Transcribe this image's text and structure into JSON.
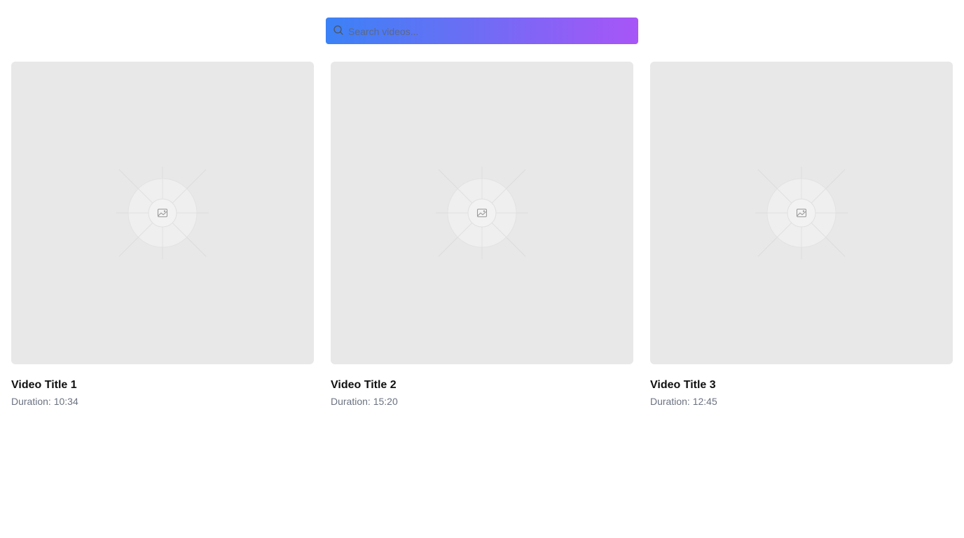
{
  "search": {
    "placeholder": "Search videos..."
  },
  "videos": [
    {
      "title": "Video Title 1",
      "duration": "Duration: 10:34"
    },
    {
      "title": "Video Title 2",
      "duration": "Duration: 15:20"
    },
    {
      "title": "Video Title 3",
      "duration": "Duration: 12:45"
    }
  ],
  "colors": {
    "search_gradient_start": "#3b82f6",
    "search_gradient_end": "#a855f7",
    "thumbnail_bg": "#e8e8e8",
    "duration_text": "#6b7280"
  },
  "icons": {
    "search": "search-icon",
    "thumbnail": "image-placeholder-icon"
  }
}
